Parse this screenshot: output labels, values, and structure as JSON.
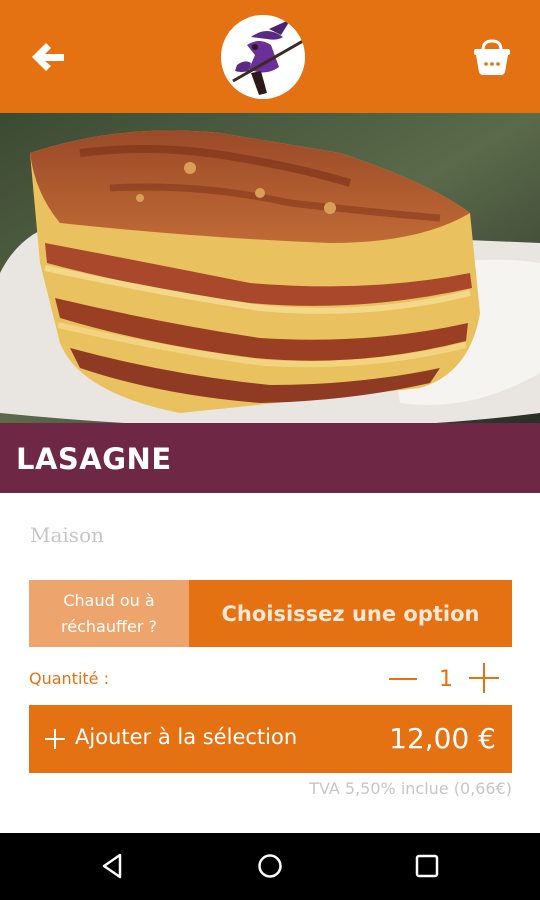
{
  "header": {
    "back_icon": "arrow-left-icon",
    "logo_icon": "witch-on-broom-logo",
    "basket_icon": "basket-icon",
    "accent_color": "#e47112"
  },
  "product": {
    "image_subject": "lasagne-photo",
    "title": "LASAGNE",
    "subtitle": "Maison",
    "band_color": "#6e2744"
  },
  "option": {
    "label": "Chaud ou à\nréchauffer ?",
    "select_text": "Choisissez une option"
  },
  "quantity": {
    "label": "Quantité :",
    "value": "1",
    "minus_icon": "minus-icon",
    "plus_icon": "plus-icon"
  },
  "add_button": {
    "label": "Ajouter à la sélection",
    "price": "12,00 €",
    "icon": "plus-icon"
  },
  "tax_note": "TVA 5,50% inclue (0,66€)",
  "system_nav": {
    "back_icon": "triangle-back-icon",
    "home_icon": "circle-home-icon",
    "recent_icon": "square-recents-icon"
  }
}
